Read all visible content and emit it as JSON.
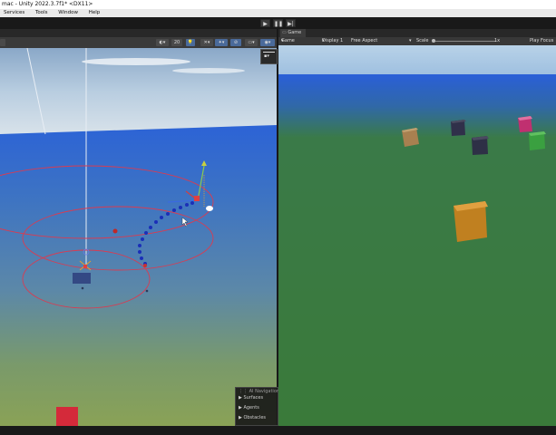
{
  "window": {
    "title": "mac - Unity 2022.3.7f1* <DX11>"
  },
  "menu": {
    "items": [
      "Services",
      "Tools",
      "Window",
      "Help"
    ]
  },
  "playbar": {
    "play_icon": "play-icon",
    "pause_icon": "pause-icon",
    "step_icon": "step-icon"
  },
  "game_tab": {
    "label": "Game"
  },
  "game_toolbar": {
    "mode": "Game",
    "display": "Display 1",
    "aspect": "Free Aspect",
    "scale_label": "Scale",
    "scale_value": "1x",
    "play_focused": "Play Focus"
  },
  "scene_toolbar": {
    "grid_count": "20"
  },
  "ai_navigation": {
    "title": "AI Navigation",
    "items": [
      "Surfaces",
      "Agents",
      "Obstacles"
    ]
  },
  "colors": {
    "accent": "#4a6a9a",
    "sky": "#2a5fd8",
    "ground": "#3a7a40"
  }
}
